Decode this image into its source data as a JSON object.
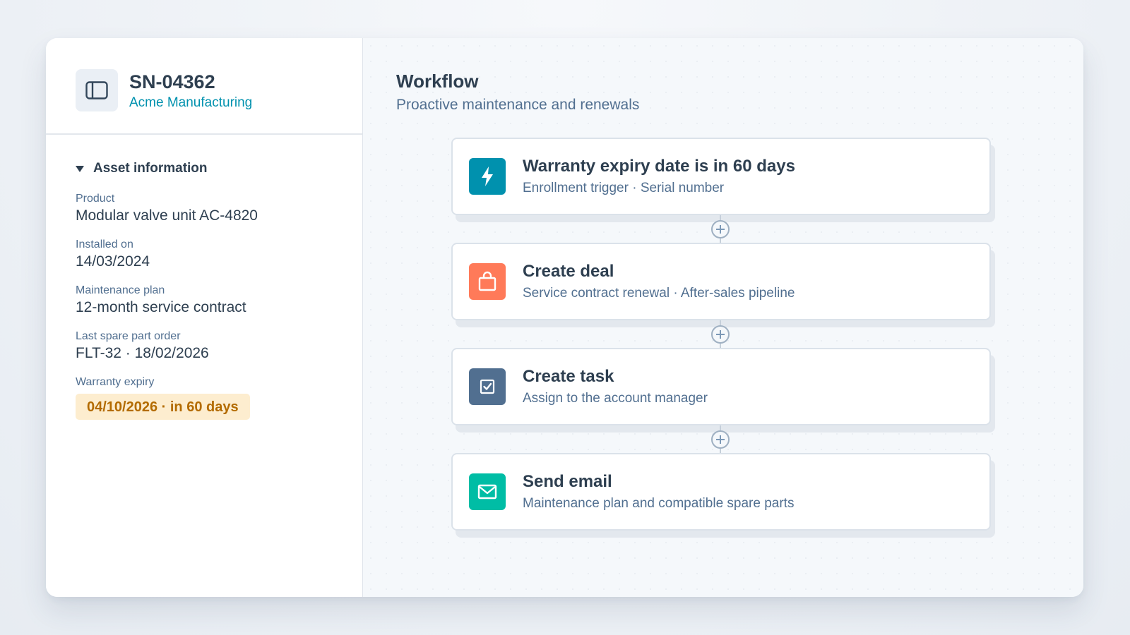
{
  "record": {
    "id": "SN-04362",
    "company": "Acme Manufacturing",
    "icon": "sidebar-panel-icon"
  },
  "asset_section": {
    "title": "Asset information",
    "fields": [
      {
        "label": "Product",
        "value": "Modular valve unit AC-4820"
      },
      {
        "label": "Installed on",
        "value": "14/03/2024"
      },
      {
        "label": "Maintenance plan",
        "value": "12-month service contract"
      },
      {
        "label": "Last spare part order",
        "value": "FLT-32 · 18/02/2026"
      }
    ],
    "warranty": {
      "label": "Warranty expiry",
      "value": "04/10/2026 · in 60 days"
    }
  },
  "workflow": {
    "title": "Workflow",
    "subtitle": "Proactive maintenance and renewals",
    "steps": [
      {
        "title": "Warranty expiry date is in 60 days",
        "description": "Enrollment trigger · Serial number",
        "icon": "lightning-icon",
        "color": "#0091ae"
      },
      {
        "title": "Create deal",
        "description": "Service contract renewal · After-sales pipeline",
        "icon": "shopping-bag-icon",
        "color": "#ff7a59"
      },
      {
        "title": "Create task",
        "description": "Assign to the account manager",
        "icon": "checkbox-icon",
        "color": "#516f90"
      },
      {
        "title": "Send email",
        "description": "Maintenance plan and compatible spare parts",
        "icon": "envelope-icon",
        "color": "#00bda5"
      }
    ]
  },
  "colors": {
    "accent": "#0091ae",
    "warranty_badge_bg": "#fdedcf",
    "warranty_badge_text": "#b36b00"
  }
}
